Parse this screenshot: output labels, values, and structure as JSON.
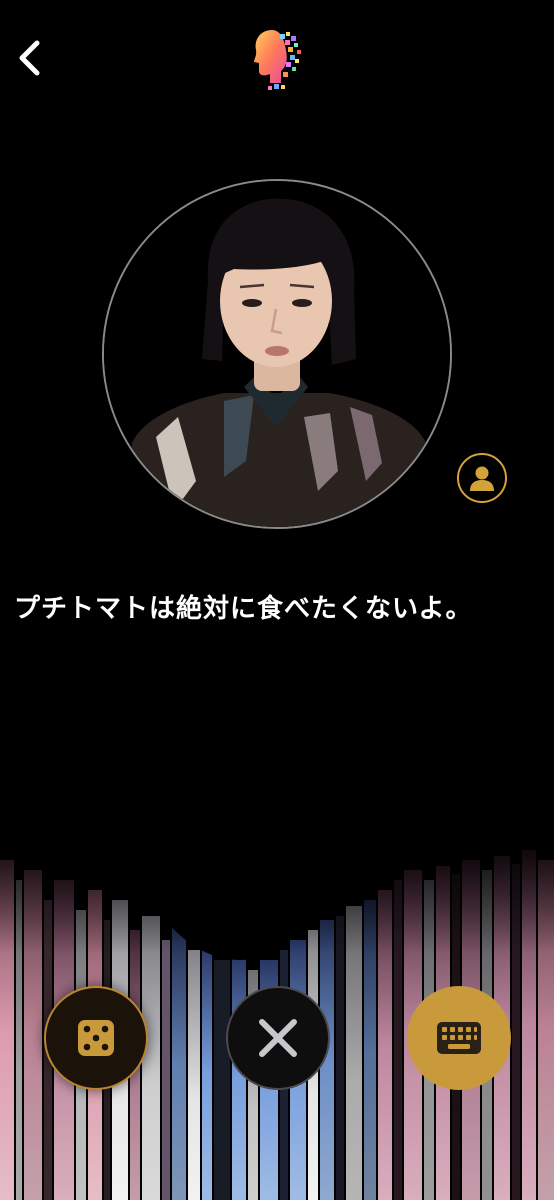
{
  "header": {
    "back_icon": "chevron-left-icon",
    "logo_icon": "pixel-head-logo-icon"
  },
  "avatar": {
    "ring_color": "#8a8a8a"
  },
  "profile_button": {
    "icon": "person-icon",
    "accent": "#d4a23b"
  },
  "speech": {
    "text": "プチトマトは絶対に食べたくないよ。"
  },
  "controls": {
    "dice_icon": "dice-five-icon",
    "close_icon": "close-x-icon",
    "keyboard_icon": "keyboard-icon",
    "accent": "#c99a3c"
  }
}
